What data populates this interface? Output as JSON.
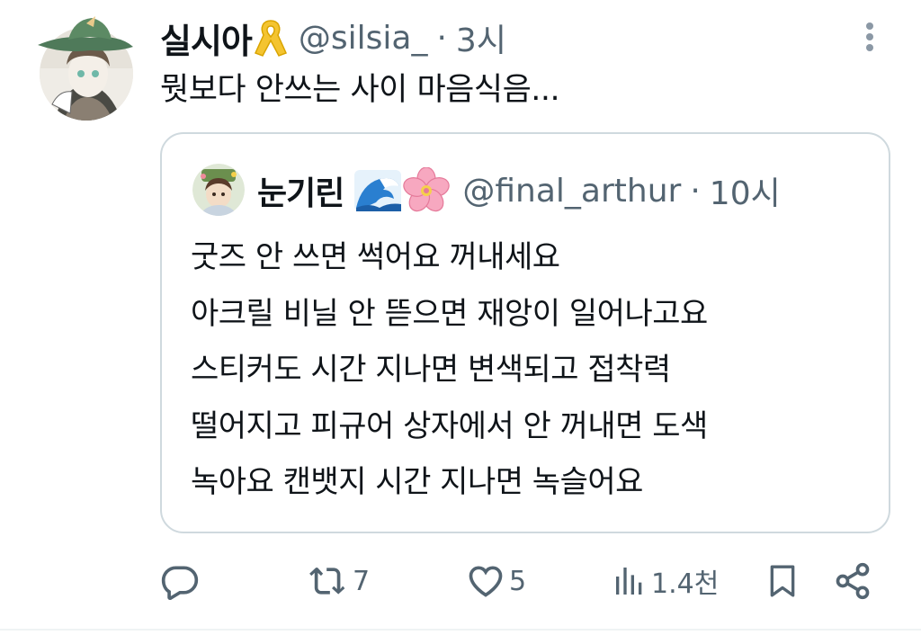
{
  "tweet": {
    "display_name": "실시아",
    "name_emoji": "yellow-ribbon",
    "handle": "@silsia_",
    "separator": "·",
    "time": "3시",
    "text": "뭣보다 안쓰는 사이 마음식음..."
  },
  "quote": {
    "display_name": "눈기린",
    "name_emojis": [
      "wave",
      "cherry-blossom"
    ],
    "handle": "@final_arthur",
    "separator": "·",
    "time": "10시",
    "lines": [
      "굿즈 안 쓰면 썩어요 꺼내세요",
      "아크릴 비닐 안 뜯으면 재앙이 일어나고요",
      "스티커도 시간 지나면 변색되고 접착력",
      "떨어지고 피규어 상자에서 안 꺼내면 도색",
      "녹아요 캔뱃지 시간 지나면 녹슬어요"
    ]
  },
  "actions": {
    "reply": {
      "icon": "reply-icon",
      "count": ""
    },
    "retweet": {
      "icon": "retweet-icon",
      "count": "7"
    },
    "like": {
      "icon": "heart-icon",
      "count": "5"
    },
    "views": {
      "icon": "views-icon",
      "count": "1.4천"
    },
    "bookmark": {
      "icon": "bookmark-icon"
    },
    "share": {
      "icon": "share-icon"
    }
  },
  "colors": {
    "text": "#0f1419",
    "secondary": "#536471",
    "border": "#cfd9de",
    "icon": "#536471"
  }
}
